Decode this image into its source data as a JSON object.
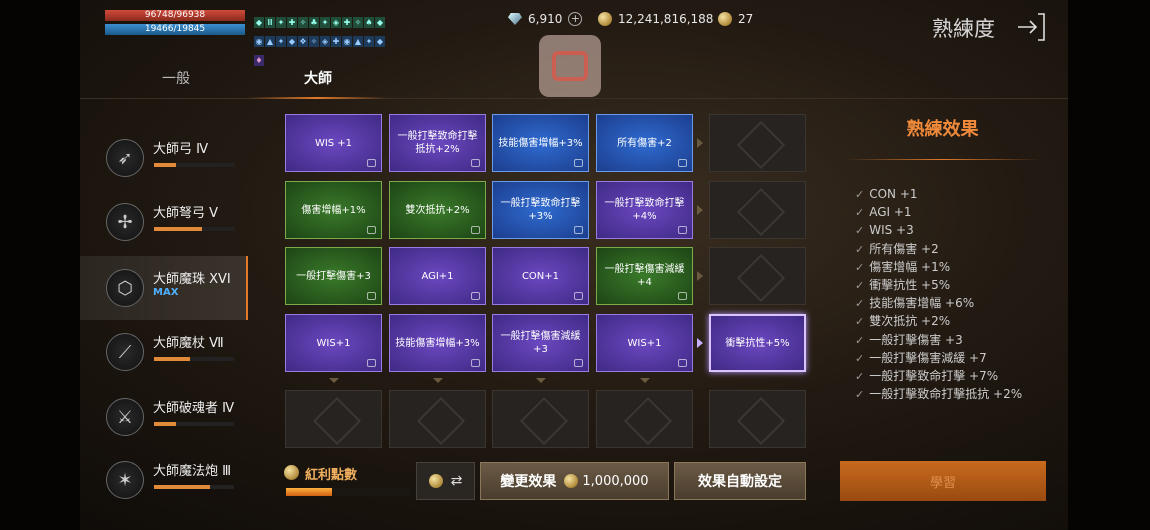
{
  "status": {
    "hp": "96748/96938",
    "mp": "19466/19845"
  },
  "currency": {
    "gems": "6,910",
    "gold": "12,241,816,188",
    "tokens": "27"
  },
  "header": {
    "title": "熟練度"
  },
  "tabs": [
    {
      "label": "一般"
    },
    {
      "label": "大師"
    }
  ],
  "weapons": [
    {
      "name": "大師弓 Ⅳ",
      "progress": 0.28,
      "icon": "bow-icon"
    },
    {
      "name": "大師弩弓 Ⅴ",
      "progress": 0.6,
      "icon": "crossbow-icon"
    },
    {
      "name": "大師魔珠 XVI",
      "badge": "MAX",
      "icon": "orb-icon"
    },
    {
      "name": "大師魔杖 Ⅶ",
      "progress": 0.45,
      "icon": "wand-icon"
    },
    {
      "name": "大師破魂者 Ⅳ",
      "progress": 0.28,
      "icon": "soulbreaker-icon"
    },
    {
      "name": "大師魔法炮 Ⅲ",
      "progress": 0.7,
      "icon": "magic-cannon-icon"
    }
  ],
  "grid": [
    [
      {
        "text": "WIS +1",
        "color": "purple"
      },
      {
        "text": "一般打擊致命打擊抵抗+2%",
        "color": "purple"
      },
      {
        "text": "技能傷害增幅+3%",
        "color": "blue"
      },
      {
        "text": "所有傷害+2",
        "color": "blue"
      },
      {
        "text": "",
        "color": "empty"
      }
    ],
    [
      {
        "text": "傷害增幅+1%",
        "color": "green"
      },
      {
        "text": "雙次抵抗+2%",
        "color": "green"
      },
      {
        "text": "一般打擊致命打擊+3%",
        "color": "blue"
      },
      {
        "text": "一般打擊致命打擊+4%",
        "color": "purple"
      },
      {
        "text": "",
        "color": "empty"
      }
    ],
    [
      {
        "text": "一般打擊傷害+3",
        "color": "green"
      },
      {
        "text": "AGI+1",
        "color": "purple"
      },
      {
        "text": "CON+1",
        "color": "purple"
      },
      {
        "text": "一般打擊傷害減緩+4",
        "color": "green"
      },
      {
        "text": "",
        "color": "empty"
      }
    ],
    [
      {
        "text": "WIS+1",
        "color": "purple"
      },
      {
        "text": "技能傷害增幅+3%",
        "color": "purple"
      },
      {
        "text": "一般打擊傷害減緩+3",
        "color": "purple"
      },
      {
        "text": "WIS+1",
        "color": "purple"
      },
      {
        "text": "衝擊抗性+5%",
        "color": "purple"
      }
    ],
    [
      {
        "text": "",
        "color": "empty"
      },
      {
        "text": "",
        "color": "empty"
      },
      {
        "text": "",
        "color": "empty"
      },
      {
        "text": "",
        "color": "empty"
      },
      {
        "text": "",
        "color": "empty"
      }
    ]
  ],
  "effects": {
    "title": "熟練效果",
    "items": [
      "CON +1",
      "AGI +1",
      "WIS +3",
      "所有傷害 +2",
      "傷害增幅 +1%",
      "衝擊抗性 +5%",
      "技能傷害增幅 +6%",
      "雙次抵抗 +2%",
      "一般打擊傷害 +3",
      "一般打擊傷害減緩 +7",
      "一般打擊致命打擊 +7%",
      "一般打擊致命打擊抵抗 +2%"
    ]
  },
  "bottom": {
    "bonus_label": "紅利點數",
    "bonus_progress": 0.37,
    "swap_symbol": "⇄",
    "change_label": "變更效果",
    "change_price": "1,000,000",
    "auto_label": "效果自動設定",
    "learn_label": "學習"
  },
  "colors": {
    "accent": "#e07a2a",
    "purple": "#6b48c0",
    "blue": "#2f6bd0",
    "green": "#3a7a2a"
  }
}
